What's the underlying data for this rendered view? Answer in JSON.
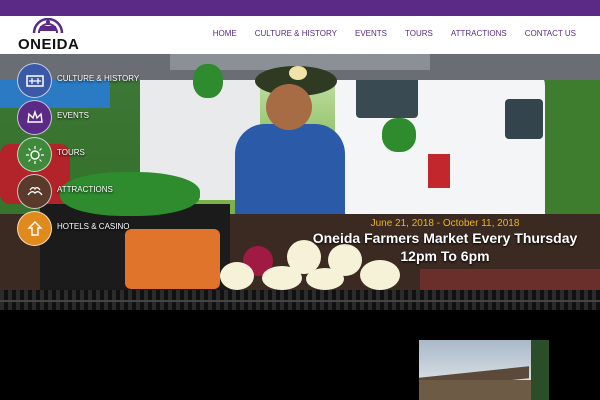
{
  "brand": {
    "name": "ONEIDA",
    "purple": "#5b2a86"
  },
  "nav": {
    "items": [
      {
        "label": "HOME"
      },
      {
        "label": "CULTURE & HISTORY"
      },
      {
        "label": "EVENTS"
      },
      {
        "label": "TOURS"
      },
      {
        "label": "ATTRACTIONS"
      },
      {
        "label": "CONTACT US"
      }
    ]
  },
  "sidenav": {
    "items": [
      {
        "label": "CULTURE & HISTORY",
        "color": "#3a5aa8",
        "icon": "wampum-icon"
      },
      {
        "label": "EVENTS",
        "color": "#5b2a86",
        "icon": "crown-icon"
      },
      {
        "label": "TOURS",
        "color": "#3e8a3a",
        "icon": "sun-icon"
      },
      {
        "label": "ATTRACTIONS",
        "color": "#5a3a2a",
        "icon": "hands-icon"
      },
      {
        "label": "HOTELS & CASINO",
        "color": "#e08a1e",
        "icon": "clan-icon"
      }
    ]
  },
  "hero": {
    "date": "June 21, 2018 - October 11, 2018",
    "title": "Oneida Farmers Market Every Thursday 12pm To 6pm"
  }
}
